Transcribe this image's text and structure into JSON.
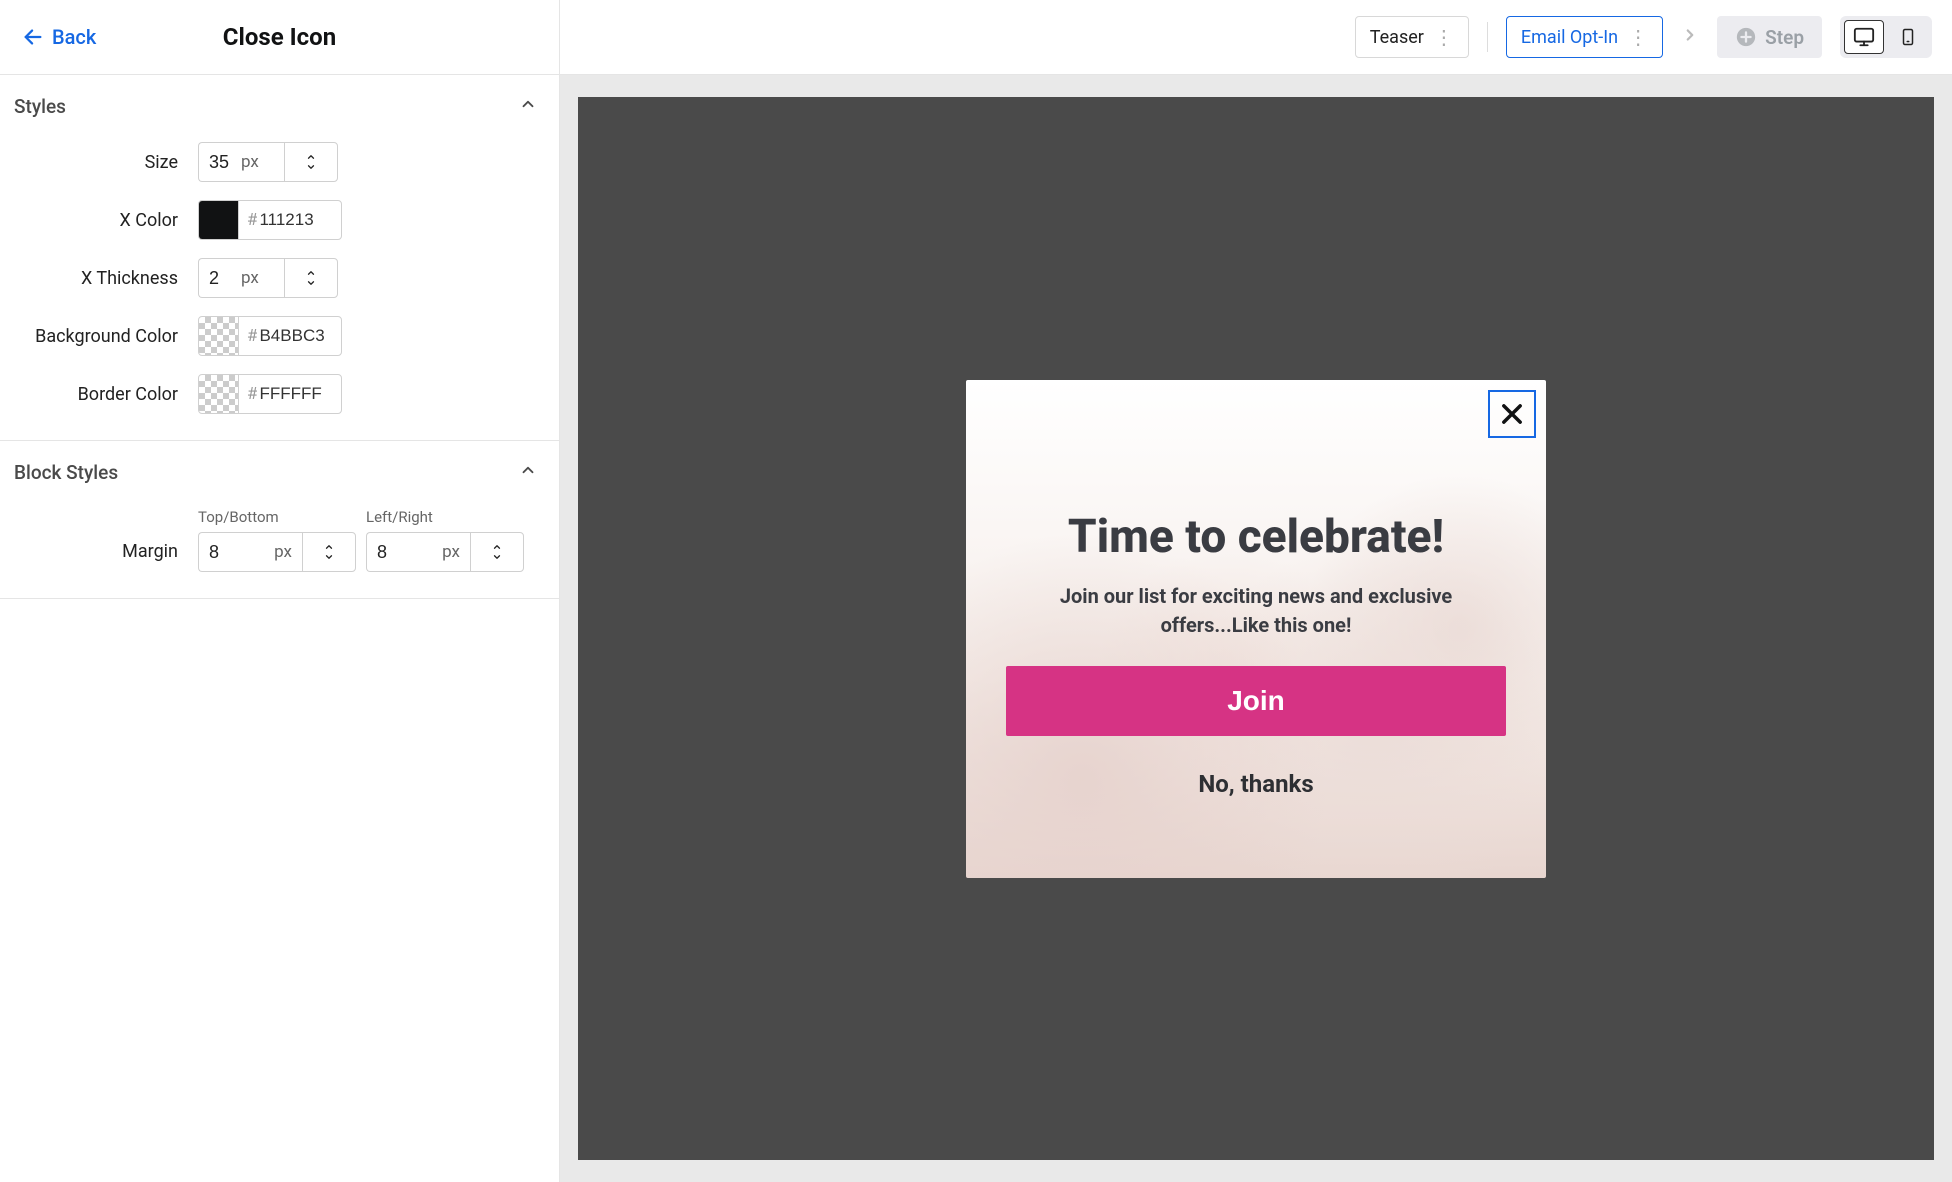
{
  "header": {
    "back": "Back",
    "title": "Close Icon"
  },
  "sections": {
    "styles": {
      "title": "Styles",
      "size_label": "Size",
      "size_value": "35",
      "size_unit": "px",
      "xcolor_label": "X Color",
      "xcolor_value": "111213",
      "xthick_label": "X Thickness",
      "xthick_value": "2",
      "xthick_unit": "px",
      "bgcolor_label": "Background Color",
      "bgcolor_value": "B4BBC3",
      "bordercolor_label": "Border Color",
      "bordercolor_value": "FFFFFF"
    },
    "block": {
      "title": "Block Styles",
      "margin_label": "Margin",
      "tb_label": "Top/Bottom",
      "tb_value": "8",
      "tb_unit": "px",
      "lr_label": "Left/Right",
      "lr_value": "8",
      "lr_unit": "px"
    }
  },
  "topbar": {
    "teaser": "Teaser",
    "optin": "Email Opt-In",
    "add_step": "Step"
  },
  "popup": {
    "title": "Time to celebrate!",
    "subtitle": "Join our list for exciting news and exclusive offers...Like this one!",
    "join": "Join",
    "decline": "No, thanks"
  },
  "colors": {
    "x_swatch": "#111213"
  }
}
